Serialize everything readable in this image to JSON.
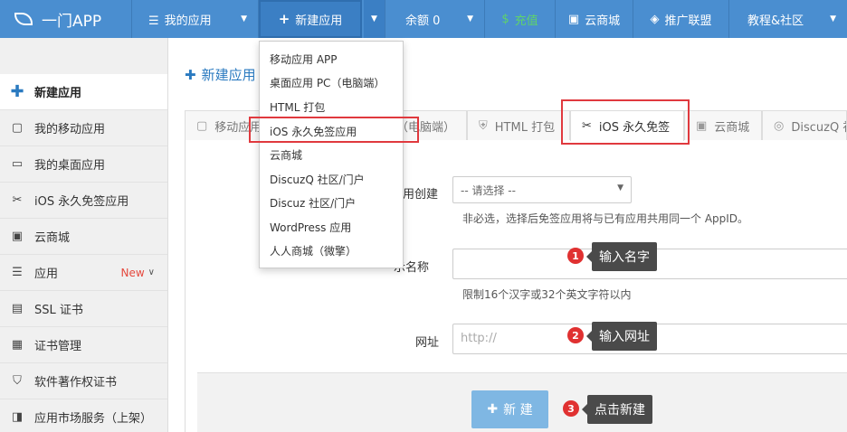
{
  "header": {
    "logo_text": "一门APP",
    "my_apps": "我的应用",
    "new_app": "新建应用",
    "balance": "余额 0",
    "recharge": "充值",
    "cloud_mall": "云商城",
    "promotion": "推广联盟",
    "tutorial": "教程&社区"
  },
  "dropdown": {
    "items": [
      "移动应用 APP",
      "桌面应用 PC（电脑端）",
      "HTML 打包",
      "iOS 永久免签应用",
      "云商城",
      "DiscuzQ 社区/门户",
      "Discuz 社区/门户",
      "WordPress 应用",
      "人人商城（微擎）"
    ]
  },
  "sidebar": {
    "items": [
      {
        "label": "新建应用",
        "icon": "plus-icon"
      },
      {
        "label": "我的移动应用",
        "icon": "phone-icon"
      },
      {
        "label": "我的桌面应用",
        "icon": "monitor-icon"
      },
      {
        "label": "iOS 永久免签应用",
        "icon": "scissors-icon"
      },
      {
        "label": "云商城",
        "icon": "store-icon"
      },
      {
        "label": "应用",
        "icon": "menu-icon",
        "badge": "New"
      },
      {
        "label": "SSL 证书",
        "icon": "ssl-icon"
      },
      {
        "label": "证书管理",
        "icon": "certificate-icon"
      },
      {
        "label": "软件著作权证书",
        "icon": "copyright-icon"
      },
      {
        "label": "应用市场服务（上架）",
        "icon": "market-icon"
      }
    ]
  },
  "main": {
    "page_title": "新建应用",
    "tabs": [
      {
        "label": "移动应用",
        "icon": "phone-icon"
      },
      {
        "label": "（电脑端）",
        "icon": ""
      },
      {
        "label": "HTML 打包",
        "icon": "html5-icon"
      },
      {
        "label": "iOS 永久免签",
        "icon": "scissors-icon"
      },
      {
        "label": "云商城",
        "icon": "store-icon"
      },
      {
        "label": "DiscuzQ 社",
        "icon": "discuz-icon"
      }
    ],
    "form": {
      "link_label": "用创建",
      "select_value": "-- 请选择 --",
      "link_hint": "非必选，选择后免签应用将与已有应用共用同一个 AppID。",
      "name_label": "示名称",
      "name_value": "",
      "name_hint": "限制16个汉字或32个英文字符以内",
      "url_label": "网址",
      "url_placeholder": "http://",
      "create_button": "新 建"
    }
  },
  "callouts": [
    {
      "num": "1",
      "text": "输入名字"
    },
    {
      "num": "2",
      "text": "输入网址"
    },
    {
      "num": "3",
      "text": "点击新建"
    }
  ],
  "colors": {
    "header_bg": "#4a8ed0",
    "accent": "#2a7ac0",
    "highlight": "#e0393e",
    "recharge": "#5fd36a"
  }
}
